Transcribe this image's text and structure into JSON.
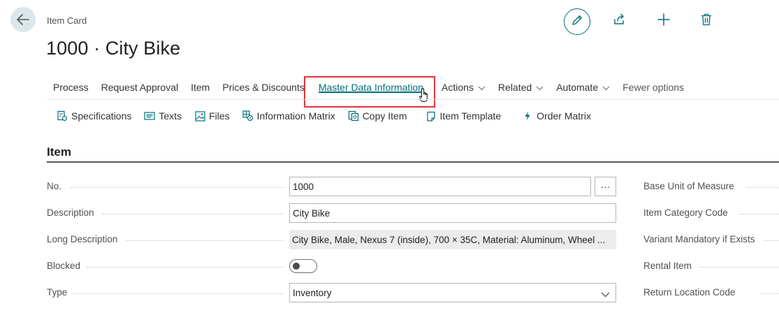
{
  "header": {
    "breadcrumb": "Item Card",
    "title": "1000 · City Bike"
  },
  "top_actions": {
    "icons": [
      "edit-icon",
      "share-icon",
      "plus-icon",
      "delete-icon"
    ]
  },
  "actionbar": {
    "items": [
      {
        "label": "Process",
        "has_chevron": false
      },
      {
        "label": "Request Approval",
        "has_chevron": false
      },
      {
        "label": "Item",
        "has_chevron": false
      },
      {
        "label": "Prices & Discounts",
        "has_chevron": false
      },
      {
        "label": "Master Data Information",
        "has_chevron": false,
        "active": true
      },
      {
        "label": "Actions",
        "has_chevron": true
      },
      {
        "label": "Related",
        "has_chevron": true
      },
      {
        "label": "Automate",
        "has_chevron": true
      },
      {
        "label": "Fewer options",
        "has_chevron": false
      }
    ]
  },
  "subbar": {
    "items": [
      {
        "label": "Specifications",
        "icon": "specifications-icon"
      },
      {
        "label": "Texts",
        "icon": "texts-icon"
      },
      {
        "label": "Files",
        "icon": "files-icon"
      },
      {
        "label": "Information Matrix",
        "icon": "matrix-icon"
      },
      {
        "label": "Copy Item",
        "icon": "copy-icon"
      },
      {
        "label": "Item Template",
        "icon": "template-icon"
      },
      {
        "label": "Order Matrix",
        "icon": "lightning-icon"
      }
    ]
  },
  "section": {
    "title": "Item"
  },
  "fields_left": {
    "no": {
      "label": "No.",
      "value": "1000",
      "assist": "···"
    },
    "description": {
      "label": "Description",
      "value": "City Bike"
    },
    "long_description": {
      "label": "Long Description",
      "value": "City Bike, Male, Nexus 7 (inside), 700 × 35C, Material: Aluminum,  Wheel ..."
    },
    "blocked": {
      "label": "Blocked",
      "value": false
    },
    "type": {
      "label": "Type",
      "value": "Inventory"
    }
  },
  "fields_right": [
    {
      "label": "Base Unit of Measure"
    },
    {
      "label": "Item Category Code"
    },
    {
      "label": "Variant Mandatory if Exists"
    },
    {
      "label": "Rental Item"
    },
    {
      "label": "Return Location Code"
    }
  ],
  "colors": {
    "accent": "#00707a",
    "highlight": "#e0353c"
  }
}
